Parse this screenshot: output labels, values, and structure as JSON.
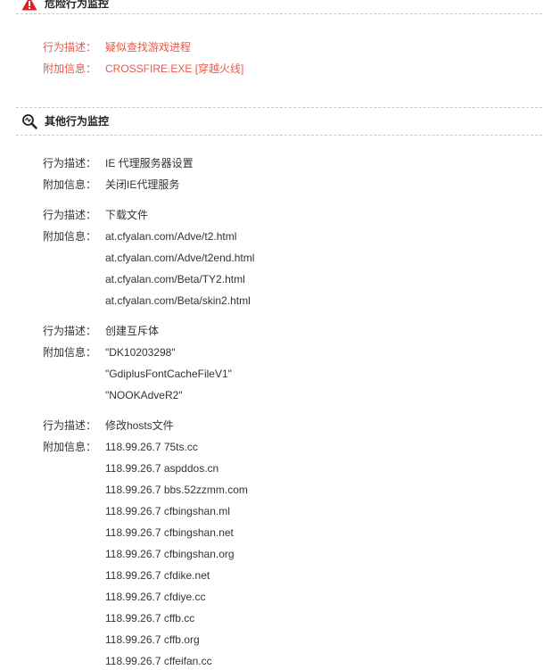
{
  "danger_section": {
    "title": "危险行为监控",
    "icon": "warning-icon",
    "color": "#e02020",
    "items": [
      {
        "label": "行为描述：",
        "values": [
          "疑似查找游戏进程"
        ]
      },
      {
        "label": "附加信息：",
        "values": [
          "CROSSFIRE.EXE [穿越火线]"
        ]
      }
    ]
  },
  "other_section": {
    "title": "其他行为监控",
    "icon": "magnifier-icon",
    "groups": [
      {
        "desc_label": "行为描述：",
        "desc": "IE 代理服务器设置",
        "info_label": "附加信息：",
        "info": [
          "关闭IE代理服务"
        ]
      },
      {
        "desc_label": "行为描述：",
        "desc": "下载文件",
        "info_label": "附加信息：",
        "info": [
          "at.cfyalan.com/Adve/t2.html",
          "at.cfyalan.com/Adve/t2end.html",
          "at.cfyalan.com/Beta/TY2.html",
          "at.cfyalan.com/Beta/skin2.html"
        ]
      },
      {
        "desc_label": "行为描述：",
        "desc": "创建互斥体",
        "info_label": "附加信息：",
        "info": [
          "\"DK10203298\"",
          "\"GdiplusFontCacheFileV1\"",
          "\"NOOKAdveR2\""
        ]
      },
      {
        "desc_label": "行为描述：",
        "desc": "修改hosts文件",
        "info_label": "附加信息：",
        "info": [
          "118.99.26.7 75ts.cc",
          "118.99.26.7 aspddos.cn",
          "118.99.26.7 bbs.52zzmm.com",
          "118.99.26.7 cfbingshan.ml",
          "118.99.26.7 cfbingshan.net",
          "118.99.26.7 cfbingshan.org",
          "118.99.26.7 cfdike.net",
          "118.99.26.7 cfdiye.cc",
          "118.99.26.7 cffb.cc",
          "118.99.26.7 cffb.org",
          "118.99.26.7 cffeifan.cc"
        ]
      }
    ]
  }
}
